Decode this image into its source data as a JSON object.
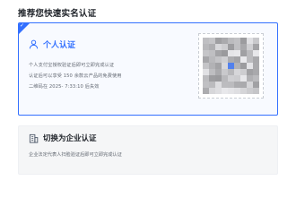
{
  "section": {
    "title": "推荐您快速实名认证"
  },
  "personal": {
    "title": "个人认证",
    "icon": "person-icon",
    "desc_line1": "个人支付宝授权验证后即可立即完成认证",
    "desc_line2": "认证后可以享受 150 余款云产品的免费使用",
    "desc_line3": "二维码在 2025-        7:33:10 后失效",
    "qr_code": "qr-code"
  },
  "company": {
    "title": "切换为企业认证",
    "icon": "building-icon",
    "desc": "企业法定代表人扫脸验证后即可立即完成认证"
  },
  "colors": {
    "accent": "#3370ff",
    "text": "#1f2329",
    "muted": "#646a73",
    "card_selected_bg": "#f8faff",
    "card_bg": "#f5f6f7"
  }
}
